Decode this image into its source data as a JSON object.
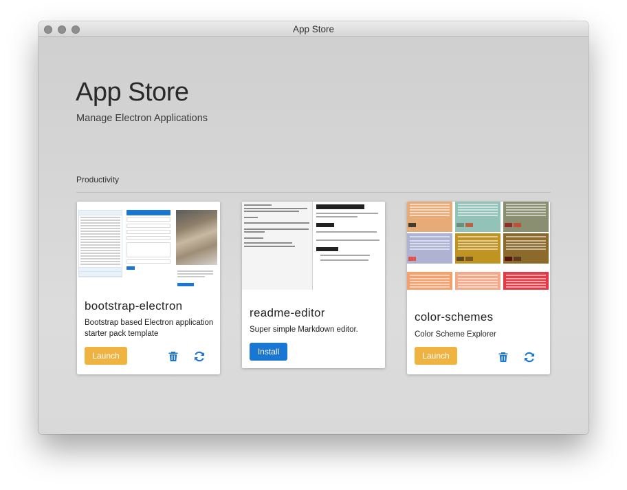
{
  "window": {
    "title": "App Store"
  },
  "header": {
    "title": "App Store",
    "subtitle": "Manage Electron Applications"
  },
  "section": {
    "label": "Productivity"
  },
  "apps": [
    {
      "name": "bootstrap-electron",
      "description": "Bootstrap based Electron application starter pack template",
      "primary_action": "Launch",
      "icons": [
        "trash-icon",
        "refresh-icon"
      ]
    },
    {
      "name": "readme-editor",
      "description": "Super simple Markdown editor.",
      "primary_action": "Install",
      "icons": []
    },
    {
      "name": "color-schemes",
      "description": "Color Scheme Explorer",
      "primary_action": "Launch",
      "icons": [
        "trash-icon",
        "refresh-icon"
      ]
    }
  ],
  "colors": {
    "launch_button": "#efb342",
    "install_button": "#1976d3",
    "icon_blue": "#1976d3"
  }
}
